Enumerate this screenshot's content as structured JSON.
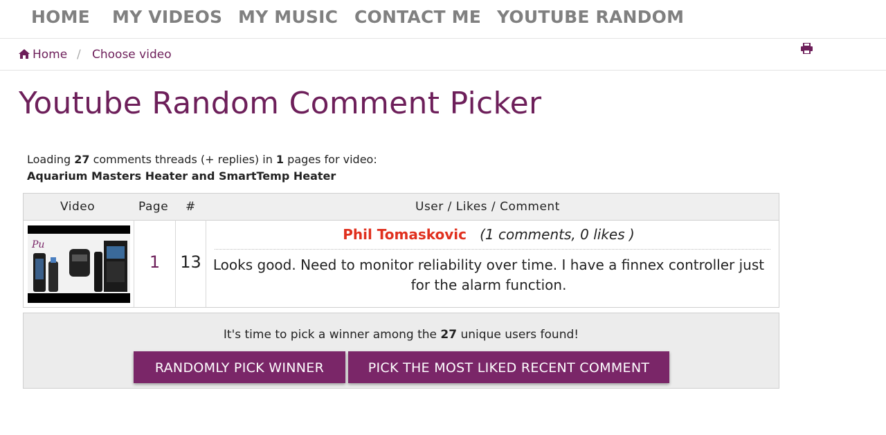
{
  "nav": {
    "items": [
      "HOME",
      "MY VIDEOS",
      "MY MUSIC",
      "CONTACT ME",
      "YOUTUBE RANDOM"
    ]
  },
  "breadcrumb": {
    "home": "Home",
    "separator": "/",
    "current": "Choose video"
  },
  "page_title": "Youtube Random Comment Picker",
  "loading": {
    "prefix": "Loading",
    "count": "27",
    "middle": "comments threads (+ replies) in",
    "pages": "1",
    "suffix": "pages for video:",
    "video_title": "Aquarium Masters Heater and SmartTemp Heater"
  },
  "table": {
    "headers": [
      "Video",
      "Page",
      "#",
      "User / Likes / Comment"
    ],
    "row": {
      "page": "1",
      "index": "13",
      "user": "Phil Tomaskovic",
      "meta": "(1 comments, 0 likes )",
      "comment": "Looks good. Need to monitor reliability over time. I have a finnex controller just for the alarm function."
    }
  },
  "panel": {
    "text_prefix": "It's time to pick a winner among the",
    "unique_count": "27",
    "text_suffix": "unique users found!",
    "random_button": "RANDOMLY PICK WINNER",
    "liked_button": "PICK THE MOST LIKED RECENT COMMENT"
  },
  "colors": {
    "accent": "#6d1f5a",
    "button": "#7a2668",
    "username": "#e0301e",
    "nav_text": "#808080"
  },
  "icons": [
    "home-icon",
    "print-icon"
  ]
}
